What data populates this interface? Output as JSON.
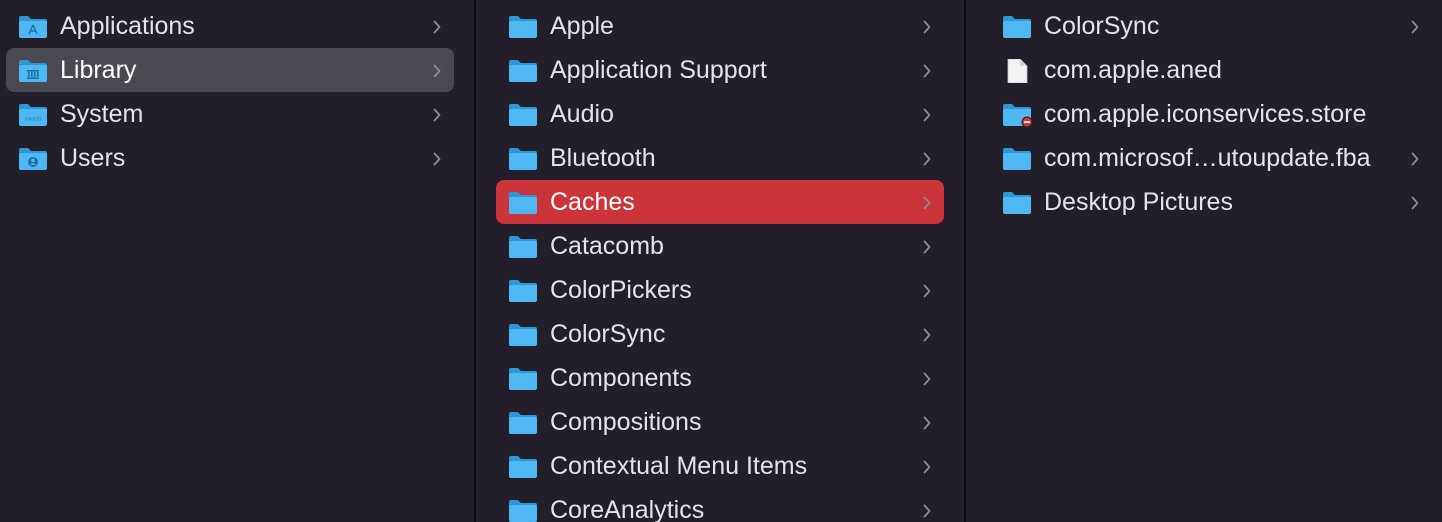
{
  "columns": [
    {
      "items": [
        {
          "label": "Applications",
          "icon": "applications-folder-icon",
          "chevron": true,
          "selected": ""
        },
        {
          "label": "Library",
          "icon": "library-folder-icon",
          "chevron": true,
          "selected": "gray"
        },
        {
          "label": "System",
          "icon": "macos-system-folder-icon",
          "chevron": true,
          "selected": ""
        },
        {
          "label": "Users",
          "icon": "users-folder-icon",
          "chevron": true,
          "selected": ""
        }
      ]
    },
    {
      "items": [
        {
          "label": "Apple",
          "icon": "folder-icon",
          "chevron": true,
          "selected": ""
        },
        {
          "label": "Application Support",
          "icon": "folder-icon",
          "chevron": true,
          "selected": ""
        },
        {
          "label": "Audio",
          "icon": "folder-icon",
          "chevron": true,
          "selected": ""
        },
        {
          "label": "Bluetooth",
          "icon": "folder-icon",
          "chevron": true,
          "selected": ""
        },
        {
          "label": "Caches",
          "icon": "folder-icon",
          "chevron": true,
          "selected": "red"
        },
        {
          "label": "Catacomb",
          "icon": "folder-icon",
          "chevron": true,
          "selected": ""
        },
        {
          "label": "ColorPickers",
          "icon": "folder-icon",
          "chevron": true,
          "selected": ""
        },
        {
          "label": "ColorSync",
          "icon": "folder-icon",
          "chevron": true,
          "selected": ""
        },
        {
          "label": "Components",
          "icon": "folder-icon",
          "chevron": true,
          "selected": ""
        },
        {
          "label": "Compositions",
          "icon": "folder-icon",
          "chevron": true,
          "selected": ""
        },
        {
          "label": "Contextual Menu Items",
          "icon": "folder-icon",
          "chevron": true,
          "selected": ""
        },
        {
          "label": "CoreAnalytics",
          "icon": "folder-icon",
          "chevron": true,
          "selected": ""
        }
      ]
    },
    {
      "items": [
        {
          "label": "ColorSync",
          "icon": "folder-icon",
          "chevron": true,
          "selected": ""
        },
        {
          "label": "com.apple.aned",
          "icon": "document-icon",
          "chevron": false,
          "selected": ""
        },
        {
          "label": "com.apple.iconservices.store",
          "icon": "restricted-folder-icon",
          "chevron": false,
          "selected": ""
        },
        {
          "label": "com.microsof…utoupdate.fba",
          "icon": "folder-icon",
          "chevron": true,
          "selected": ""
        },
        {
          "label": "Desktop Pictures",
          "icon": "folder-icon",
          "chevron": true,
          "selected": ""
        }
      ]
    }
  ],
  "colors": {
    "background": "#231f2a",
    "divider": "#0b0a0d",
    "selection_active": "#cc343b",
    "selection_inactive": "#4a4850",
    "folder_blue": "#4fb8f2",
    "text": "#e6e3e8",
    "chevron": "#8d8a92"
  }
}
